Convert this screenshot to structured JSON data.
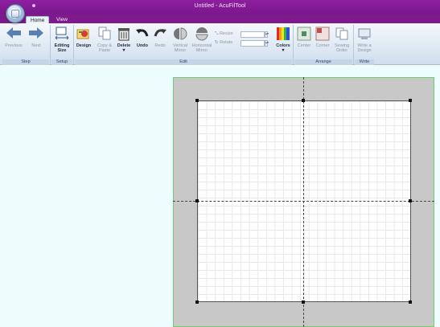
{
  "window": {
    "title": "Untitled - AcuFilTool"
  },
  "tabs": [
    {
      "label": "Home",
      "active": true
    },
    {
      "label": "View",
      "active": false
    }
  ],
  "ribbon": {
    "step": {
      "label": "Step",
      "previous": "Previous",
      "next": "Next"
    },
    "setup": {
      "label": "Setup",
      "editing_size_1": "Editing",
      "editing_size_2": "Size"
    },
    "edit": {
      "label": "Edit",
      "design": "Design",
      "copy_paste_1": "Copy &",
      "copy_paste_2": "Paste",
      "delete": "Delete",
      "undo": "Undo",
      "redo": "Redo",
      "vertical_mirror_1": "Vertical",
      "vertical_mirror_2": "Mirror",
      "horizontal_mirror_1": "Horizontal",
      "horizontal_mirror_2": "Mirror",
      "resize": "Resize",
      "rotate": "Rotate",
      "colors": "Colors"
    },
    "arrange": {
      "label": "Arrange",
      "center": "Center",
      "corner": "Corner",
      "sewing_order_1": "Sewing",
      "sewing_order_2": "Order"
    },
    "write": {
      "label": "Write",
      "write_design_1": "Write a",
      "write_design_2": "Design"
    }
  },
  "colors": {
    "title_bar": "#8e1fa0",
    "workspace_bg": "#edfdfd",
    "hoop_bg": "#c8c8c8",
    "hoop_border": "#6fcf6f",
    "design_bg": "#ffffff"
  }
}
